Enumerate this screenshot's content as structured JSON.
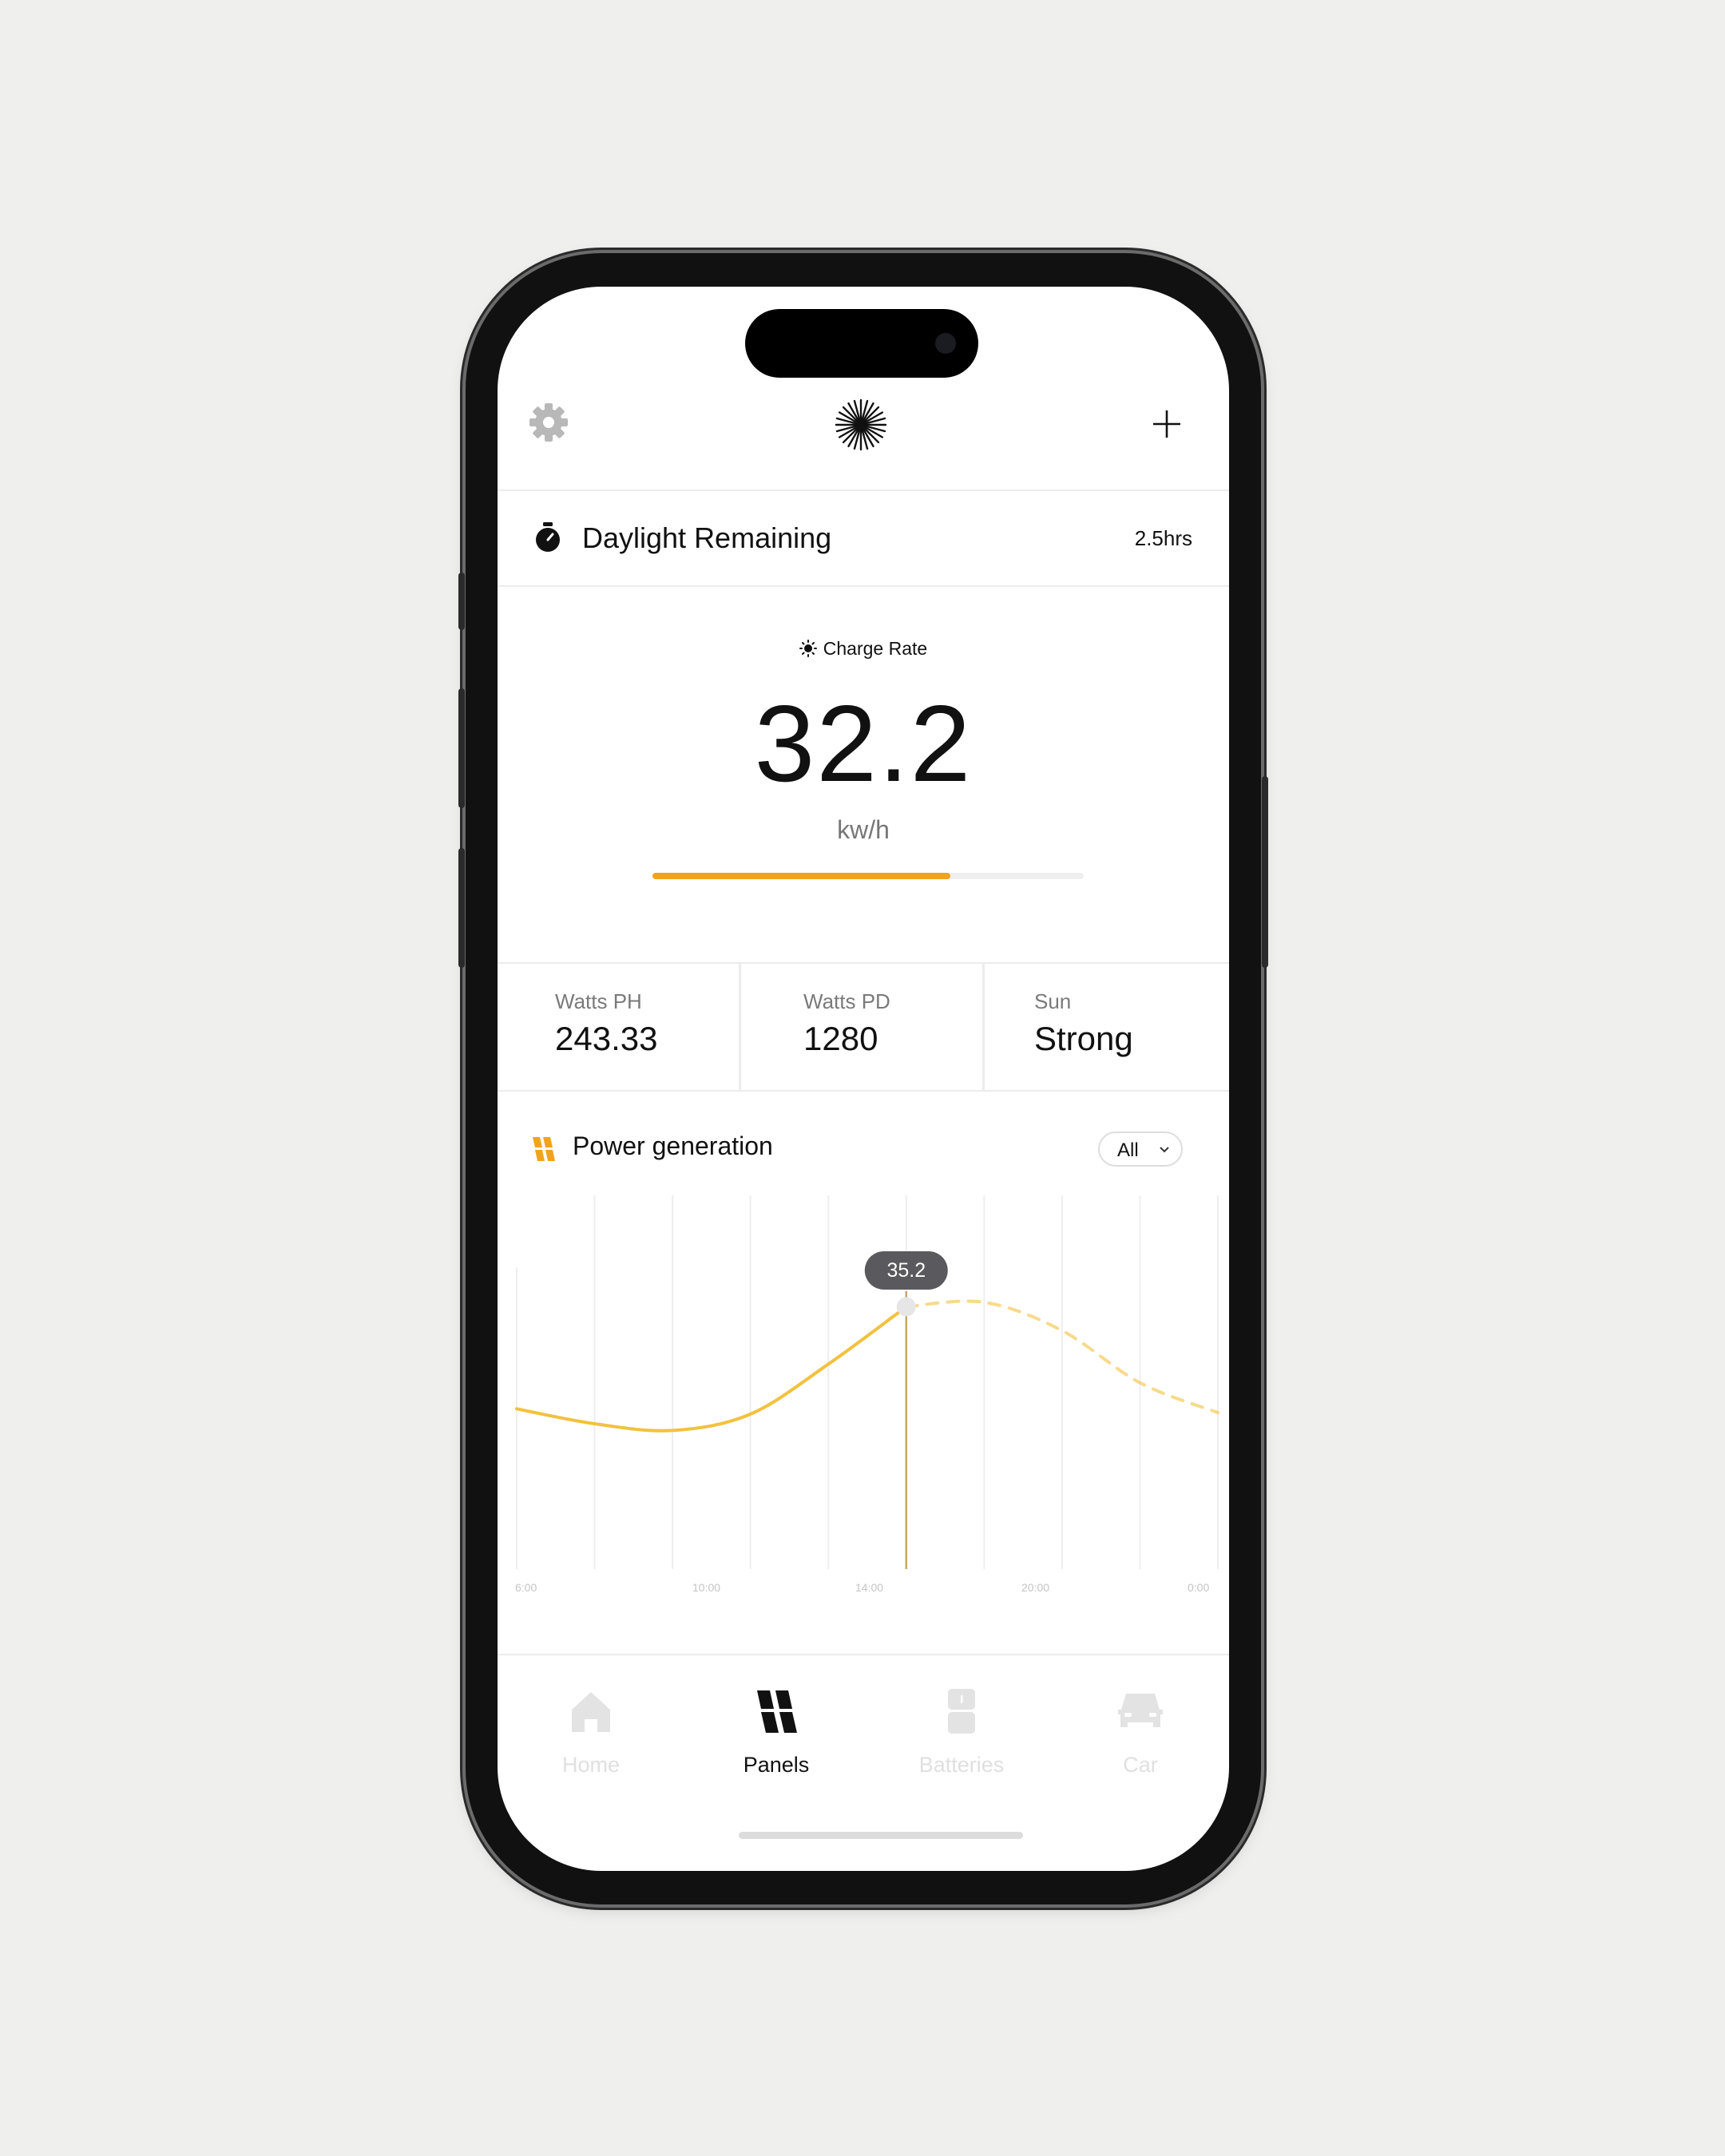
{
  "header": {
    "settings_icon": "gear-icon",
    "logo_icon": "starburst-logo-icon",
    "add_icon": "plus-icon"
  },
  "daylight": {
    "label": "Daylight Remaining",
    "value": "2.5hrs",
    "icon": "stopwatch-icon"
  },
  "charge": {
    "label": "Charge Rate",
    "value": "32.2",
    "unit": "kw/h",
    "progress": 0.69,
    "accent": "#f0a41e"
  },
  "stats": [
    {
      "label": "Watts PH",
      "value": "243.33"
    },
    {
      "label": "Watts PD",
      "value": "1280"
    },
    {
      "label": "Sun",
      "value": "Strong"
    }
  ],
  "power": {
    "title": "Power generation",
    "icon": "solar-panel-icon",
    "filter": "All",
    "tooltip": "35.2",
    "curve_color": "#f2c13e"
  },
  "chart_data": {
    "type": "line",
    "x": [
      "6:00",
      "8:00",
      "10:00",
      "12:00",
      "14:00",
      "16:00",
      "18:00",
      "20:00",
      "22:00",
      "0:00"
    ],
    "xticks": [
      "6:00",
      "10:00",
      "14:00",
      "20:00",
      "0:00"
    ],
    "series": [
      {
        "values": [
          21.5,
          19.5,
          18.6,
          20.8,
          27.5,
          35.2,
          null,
          null,
          null,
          null
        ]
      },
      {
        "values": [
          null,
          null,
          null,
          null,
          null,
          35.2,
          35.8,
          32.0,
          25.0,
          21.0
        ]
      }
    ],
    "highlight": {
      "x": "16:00",
      "y": 35.2
    },
    "ylim": [
      0,
      48
    ],
    "grid": "vertical"
  },
  "tabs": [
    {
      "label": "Home",
      "icon": "home-icon",
      "active": false
    },
    {
      "label": "Panels",
      "icon": "solar-panel-icon",
      "active": true
    },
    {
      "label": "Batteries",
      "icon": "battery-icon",
      "active": false
    },
    {
      "label": "Car",
      "icon": "car-icon",
      "active": false
    }
  ]
}
